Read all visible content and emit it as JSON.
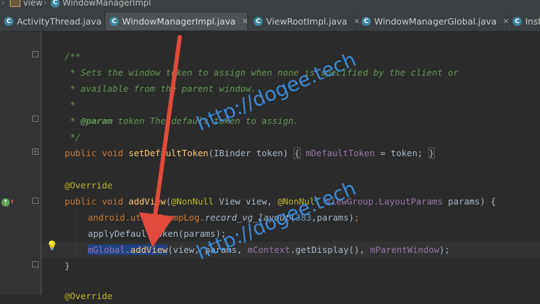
{
  "breadcrumb": {
    "folder": "view",
    "file": "WindowManagerImpl"
  },
  "tabs": [
    {
      "label": "ActivityThread.java",
      "active": false
    },
    {
      "label": "WindowManagerImpl.java",
      "active": true
    },
    {
      "label": "ViewRootImpl.java",
      "active": false
    },
    {
      "label": "WindowManagerGlobal.java",
      "active": false
    },
    {
      "label": "Inst",
      "active": false
    }
  ],
  "tab_icon_letter": "C",
  "code": {
    "l1": "/**",
    "l2a": " * Sets the window token to assign when none is specified by the client or",
    "l3": " * available from the parent window.",
    "l4": " *",
    "l5_star": " * ",
    "l5_tag": "@param",
    "l5_rest": " token The default token to assign.",
    "l6": " */",
    "l7": {
      "kw1": "public void ",
      "fn": "setDefaultToken",
      "p1": "(IBinder token) ",
      "brace_open": "{",
      "field": " mDefaultToken",
      "rest": " = token; ",
      "brace_close": "}"
    },
    "l8": "@Override",
    "l9": {
      "kw1": "public void ",
      "fn": "addView",
      "p1": "(",
      "an1": "@NonNull",
      "p2": " View view, ",
      "an2": "@NonNull",
      "p3": " ",
      "cls": "ViewGroup.LayoutParams",
      "p4": " params) {"
    },
    "l10": {
      "pkg": "android.util.SeempLog.",
      "method": "record_vg_layout",
      "p1": "(",
      "num": "383",
      "p2": ",params)",
      "semi": ";"
    },
    "l11": "applyDefaultToken(params);",
    "l12": {
      "field": "mGlobal",
      "dot": ".",
      "method": "addView",
      "p1": "(view, params, ",
      "field2": "mContext",
      "p2": ".getDisplay(), ",
      "field3": "mParentWindow",
      "p3": ");"
    },
    "l13": "}",
    "l14": "@Override"
  },
  "gutter": {
    "override_icon": "override-method-icon",
    "up_arrow": "↑",
    "bulb": "intention-bulb-icon"
  },
  "watermarks": [
    "http://dogee.tech",
    "http://dogee.tech"
  ],
  "colors": {
    "background": "#2b2b2b",
    "comment": "#629755",
    "keyword": "#cc7832",
    "function": "#ffc66d",
    "annotation": "#bbb529",
    "field": "#9876aa",
    "number": "#6897bb",
    "arrow": "#e24a3b",
    "watermark": "#3b8fe0"
  }
}
